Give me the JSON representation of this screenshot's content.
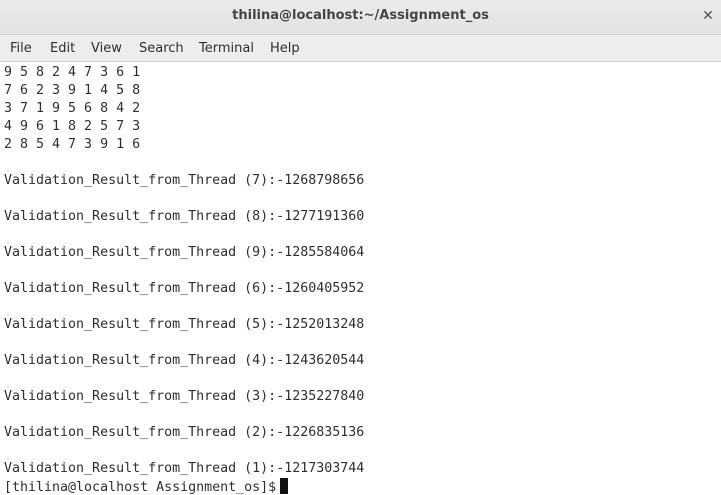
{
  "window": {
    "title": "thilina@localhost:~/Assignment_os",
    "close_glyph": "✕"
  },
  "menu": [
    "File",
    "Edit",
    "View",
    "Search",
    "Terminal",
    "Help"
  ],
  "terminal": {
    "grid_rows": [
      "9 5 8 2 4 7 3 6 1",
      "7 6 2 3 9 1 4 5 8",
      "3 7 1 9 5 6 8 4 2",
      "4 9 6 1 8 2 5 7 3",
      "2 8 5 4 7 3 9 1 6"
    ],
    "results": [
      "Validation_Result_from_Thread (7):-1268798656",
      "Validation_Result_from_Thread (8):-1277191360",
      "Validation_Result_from_Thread (9):-1285584064",
      "Validation_Result_from_Thread (6):-1260405952",
      "Validation_Result_from_Thread (5):-1252013248",
      "Validation_Result_from_Thread (4):-1243620544",
      "Validation_Result_from_Thread (3):-1235227840",
      "Validation_Result_from_Thread (2):-1226835136",
      "Validation_Result_from_Thread (1):-1217303744"
    ],
    "prompt": "[thilina@localhost Assignment_os]$"
  }
}
